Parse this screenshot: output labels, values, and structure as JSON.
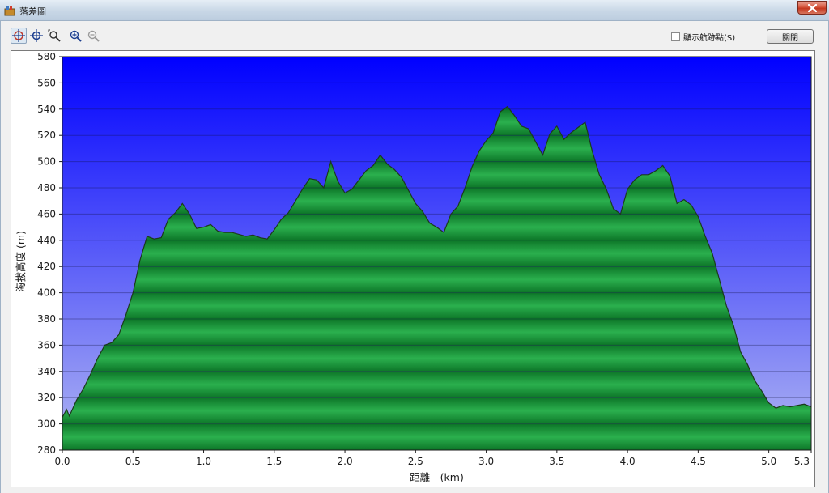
{
  "window": {
    "title": "落差圖"
  },
  "toolbar": {
    "tools": [
      "crosshair-red-icon",
      "crosshair-blue-icon",
      "zoom-box-icon",
      "zoom-in-icon",
      "zoom-out-icon"
    ],
    "checkbox_label": "顯示航跡點(S)",
    "checkbox_checked": false,
    "close_label": "關閉"
  },
  "chart_data": {
    "type": "area",
    "xlabel": "距離　(km)",
    "ylabel": "海拔高度 (m)",
    "xlim": [
      0,
      5.3
    ],
    "ylim": [
      280,
      580
    ],
    "x_ticks": [
      "0.0",
      "0.5",
      "1.0",
      "1.5",
      "2.0",
      "2.5",
      "3.0",
      "3.5",
      "4.0",
      "4.5",
      "5.0",
      "5.3"
    ],
    "y_ticks": [
      "280",
      "300",
      "320",
      "340",
      "360",
      "380",
      "400",
      "420",
      "440",
      "460",
      "480",
      "500",
      "520",
      "540",
      "560",
      "580"
    ],
    "grid": true,
    "colors": {
      "sky_top": "#0000ff",
      "sky_bottom": "#b0b6f2",
      "fill_light": "#2bb04e",
      "fill_dark": "#0d7628",
      "line": "#1c3a1c"
    },
    "series": [
      {
        "x": [
          0.0,
          0.03,
          0.05,
          0.1,
          0.15,
          0.2,
          0.25,
          0.3,
          0.35,
          0.4,
          0.45,
          0.5,
          0.55,
          0.6,
          0.65,
          0.7,
          0.75,
          0.8,
          0.85,
          0.9,
          0.95,
          1.0,
          1.05,
          1.1,
          1.15,
          1.2,
          1.3,
          1.35,
          1.4,
          1.45,
          1.5,
          1.55,
          1.6,
          1.65,
          1.7,
          1.75,
          1.8,
          1.85,
          1.9,
          1.95,
          2.0,
          2.05,
          2.1,
          2.15,
          2.2,
          2.25,
          2.3,
          2.35,
          2.4,
          2.45,
          2.5,
          2.55,
          2.6,
          2.65,
          2.7,
          2.75,
          2.8,
          2.85,
          2.9,
          2.95,
          3.0,
          3.05,
          3.1,
          3.15,
          3.2,
          3.25,
          3.3,
          3.35,
          3.4,
          3.45,
          3.5,
          3.55,
          3.6,
          3.65,
          3.7,
          3.75,
          3.8,
          3.85,
          3.9,
          3.95,
          4.0,
          4.05,
          4.1,
          4.15,
          4.2,
          4.25,
          4.3,
          4.35,
          4.4,
          4.45,
          4.5,
          4.55,
          4.6,
          4.65,
          4.7,
          4.75,
          4.8,
          4.85,
          4.9,
          4.95,
          5.0,
          5.05,
          5.1,
          5.15,
          5.2,
          5.25,
          5.3
        ],
        "y": [
          305,
          311,
          306,
          318,
          327,
          338,
          350,
          360,
          362,
          368,
          383,
          400,
          425,
          443,
          441,
          442,
          456,
          461,
          468,
          460,
          449,
          450,
          452,
          447,
          446,
          446,
          443,
          444,
          442,
          441,
          448,
          456,
          461,
          470,
          479,
          487,
          486,
          480,
          500,
          485,
          476,
          479,
          486,
          493,
          497,
          505,
          498,
          494,
          488,
          478,
          468,
          462,
          453,
          450,
          446,
          460,
          466,
          480,
          496,
          508,
          516,
          522,
          538,
          542,
          535,
          527,
          525,
          515,
          505,
          521,
          527,
          517,
          522,
          526,
          530,
          508,
          490,
          479,
          464,
          460,
          479,
          486,
          490,
          490,
          493,
          497,
          489,
          468,
          471,
          467,
          458,
          443,
          430,
          410,
          390,
          375,
          355,
          345,
          333,
          325,
          316,
          312,
          314,
          313,
          314,
          315,
          313
        ]
      }
    ]
  }
}
